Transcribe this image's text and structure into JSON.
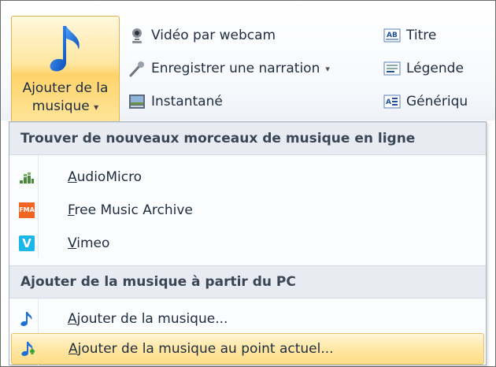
{
  "ribbon": {
    "big_button": {
      "line1": "Ajouter de la",
      "line2": "musique",
      "arrow": "▾",
      "icon": "music-note-icon"
    },
    "column1": [
      {
        "label": "Vidéo par webcam",
        "icon": "webcam-icon"
      },
      {
        "label": "Enregistrer une narration",
        "arrow": "▾",
        "icon": "microphone-icon"
      },
      {
        "label": "Instantané",
        "icon": "snapshot-icon"
      }
    ],
    "column2": [
      {
        "label": "Titre",
        "icon": "title-icon"
      },
      {
        "label": "Légende",
        "icon": "caption-icon"
      },
      {
        "label": "Génériqu",
        "icon": "credits-icon"
      }
    ]
  },
  "menu": {
    "section1": "Trouver de nouveaux morceaux de musique en ligne",
    "online": [
      {
        "accel": "A",
        "rest": "udioMicro",
        "icon": "audiomicro-icon"
      },
      {
        "accel": "F",
        "rest": "ree Music Archive",
        "icon": "fma-icon",
        "badge": "FMA"
      },
      {
        "accel": "V",
        "rest": "imeo",
        "icon": "vimeo-icon",
        "badge": "V"
      }
    ],
    "section2": "Ajouter de la musique à partir du PC",
    "local": [
      {
        "accel": "A",
        "rest": "jouter de la musique...",
        "icon": "music-note-icon"
      },
      {
        "accel": "A",
        "rest": "jouter de la musique au point actuel...",
        "icon": "music-add-icon",
        "highlighted": true
      }
    ]
  },
  "colors": {
    "highlight": "#ffe7a4",
    "section_bg": "#e8ecf2",
    "vimeo": "#1ab7ea",
    "fma": "#f26522"
  }
}
